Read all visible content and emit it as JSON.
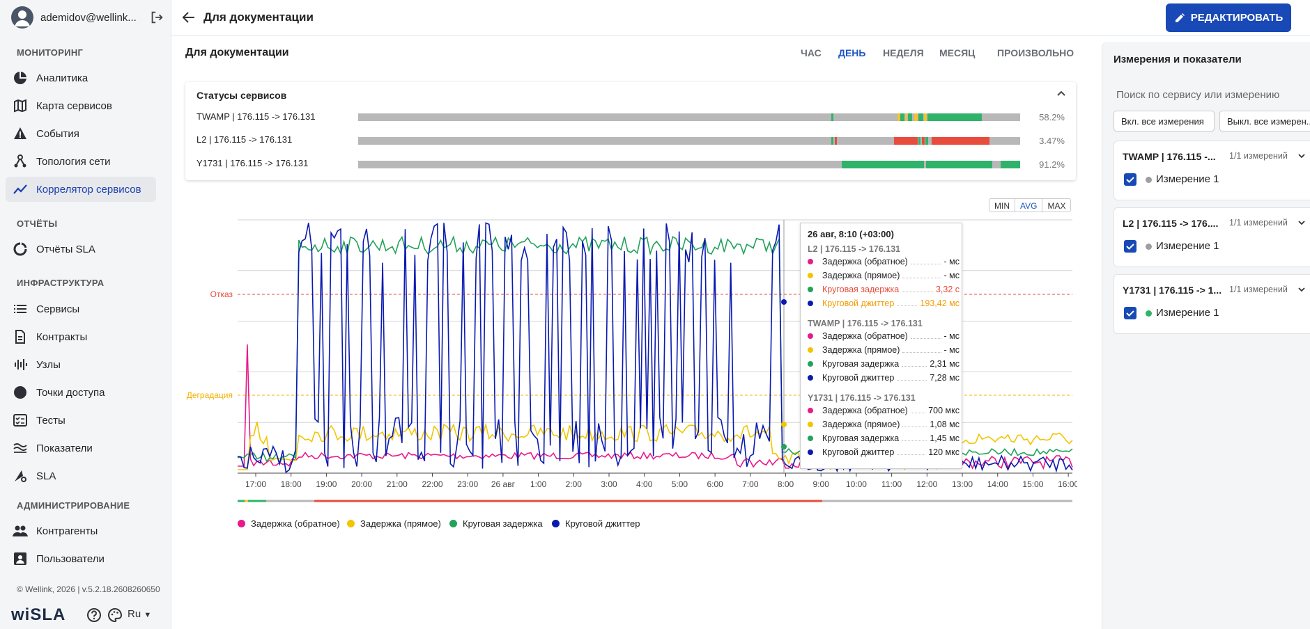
{
  "user": {
    "name": "ademidov@wellink..."
  },
  "sections": {
    "monitoring": "МОНИТОРИНГ",
    "reports": "ОТЧЁТЫ",
    "infra": "ИНФРАСТРУКТУРА",
    "admin": "АДМИНИСТРИРОВАНИЕ"
  },
  "nav": [
    {
      "label": "Аналитика",
      "icon": "analytics-icon"
    },
    {
      "label": "Карта сервисов",
      "icon": "map-icon"
    },
    {
      "label": "События",
      "icon": "warning-icon"
    },
    {
      "label": "Топология сети",
      "icon": "topology-icon"
    },
    {
      "label": "Коррелятор сервисов",
      "icon": "trend-icon",
      "active": true
    },
    {
      "label": "Отчёты SLA",
      "icon": "report-icon"
    },
    {
      "label": "Сервисы",
      "icon": "list-icon"
    },
    {
      "label": "Контракты",
      "icon": "document-icon"
    },
    {
      "label": "Узлы",
      "icon": "nodes-icon"
    },
    {
      "label": "Точки доступа",
      "icon": "access-point-icon"
    },
    {
      "label": "Тесты",
      "icon": "tests-icon"
    },
    {
      "label": "Показатели",
      "icon": "metrics-icon"
    },
    {
      "label": "SLA",
      "icon": "sla-icon"
    },
    {
      "label": "Контрагенты",
      "icon": "people-icon"
    },
    {
      "label": "Пользователи",
      "icon": "user-icon"
    }
  ],
  "footer": {
    "copyright": "© Wellink, 2026 | v.5.2.18.2608260650",
    "logo_a": "wi",
    "logo_b": "SLA",
    "lang": "Ru"
  },
  "header": {
    "title": "Для документации",
    "edit_label": "РЕДАКТИРОВАТЬ"
  },
  "page": {
    "title": "Для документации"
  },
  "ranges": [
    "ЧАС",
    "ДЕНЬ",
    "НЕДЕЛЯ",
    "МЕСЯЦ",
    "ПРОИЗВОЛЬНО"
  ],
  "active_range": "ДЕНЬ",
  "status": {
    "title": "Статусы сервисов",
    "rows": [
      {
        "name": "TWAMP | 176.115 -> 176.131",
        "percent": "58.2%"
      },
      {
        "name": "L2 | 176.115 -> 176.131",
        "percent": "3.47%"
      },
      {
        "name": "Y1731 | 176.115 -> 176.131",
        "percent": "91.2%"
      }
    ]
  },
  "colors": {
    "ok": "#2fb36a",
    "warn": "#f2c230",
    "fail": "#e74c3c",
    "nodata": "#b8b8b8",
    "accent": "#1849b6"
  },
  "aggregation": {
    "options": [
      "MIN",
      "AVG",
      "MAX"
    ],
    "active": "AVG"
  },
  "chart_data": {
    "type": "line",
    "x_ticks": [
      "17:00",
      "18:00",
      "19:00",
      "20:00",
      "21:00",
      "22:00",
      "23:00",
      "26 авг",
      "1:00",
      "2:00",
      "3:00",
      "4:00",
      "5:00",
      "6:00",
      "7:00",
      "8:00",
      "9:00",
      "10:00",
      "11:00",
      "12:00",
      "13:00",
      "14:00",
      "15:00",
      "16:00"
    ],
    "thresholds": [
      {
        "label": "Отказ",
        "color": "#e74c3c"
      },
      {
        "label": "Деградация",
        "color": "#f2b200"
      }
    ],
    "series": [
      {
        "name": "Задержка (обратное)",
        "color": "#e8198b"
      },
      {
        "name": "Задержка (прямое)",
        "color": "#f2c500"
      },
      {
        "name": "Круговая задержка",
        "color": "#23a25a"
      },
      {
        "name": "Круговой джиттер",
        "color": "#0a1ab0"
      }
    ]
  },
  "tooltip": {
    "title": "26 авг, 8:10 (+03:00)",
    "groups": [
      {
        "name": "L2 | 176.115 -> 176.131",
        "items": [
          {
            "label": "Задержка  (обратное)",
            "value": "- мс",
            "color": "#e8198b",
            "style": ""
          },
          {
            "label": "Задержка  (прямое)",
            "value": "- мс",
            "color": "#f2c500",
            "style": ""
          },
          {
            "label": "Круговая задержка",
            "value": "3,32 с",
            "color": "#23a25a",
            "style": "fail"
          },
          {
            "label": "Круговой джиттер",
            "value": "193,42 мс",
            "color": "#0a1ab0",
            "style": "warn"
          }
        ]
      },
      {
        "name": "TWAMP | 176.115 -> 176.131",
        "items": [
          {
            "label": "Задержка  (обратное)",
            "value": "- мс",
            "color": "#e8198b",
            "style": ""
          },
          {
            "label": "Задержка  (прямое)",
            "value": "- мс",
            "color": "#f2c500",
            "style": ""
          },
          {
            "label": "Круговая задержка",
            "value": "2,31 мс",
            "color": "#23a25a",
            "style": ""
          },
          {
            "label": "Круговой джиттер",
            "value": "7,28 мс",
            "color": "#0a1ab0",
            "style": ""
          }
        ]
      },
      {
        "name": "Y1731 | 176.115 -> 176.131",
        "items": [
          {
            "label": "Задержка  (обратное)",
            "value": "700 мкс",
            "color": "#e8198b",
            "style": ""
          },
          {
            "label": "Задержка  (прямое)",
            "value": "1,08 мс",
            "color": "#f2c500",
            "style": ""
          },
          {
            "label": "Круговая задержка",
            "value": "1,45 мс",
            "color": "#23a25a",
            "style": ""
          },
          {
            "label": "Круговой джиттер",
            "value": "120 мкс",
            "color": "#0a1ab0",
            "style": ""
          }
        ]
      }
    ]
  },
  "right": {
    "title": "Измерения и показатели",
    "search_placeholder": "Поиск по сервису или измерению",
    "btn_on": "Вкл. все измерения",
    "btn_off": "Выкл. все измерен...",
    "cards": [
      {
        "name": "TWAMP | 176.115 -...",
        "count": "1/1 измерений",
        "measure": "Измерение 1",
        "dot": "#9e9e9e"
      },
      {
        "name": "L2 | 176.115 -> 176....",
        "count": "1/1 измерений",
        "measure": "Измерение 1",
        "dot": "#9e9e9e"
      },
      {
        "name": "Y1731 | 176.115 -> 1...",
        "count": "1/1 измерений",
        "measure": "Измерение 1",
        "dot": "#2fb36a"
      }
    ]
  }
}
